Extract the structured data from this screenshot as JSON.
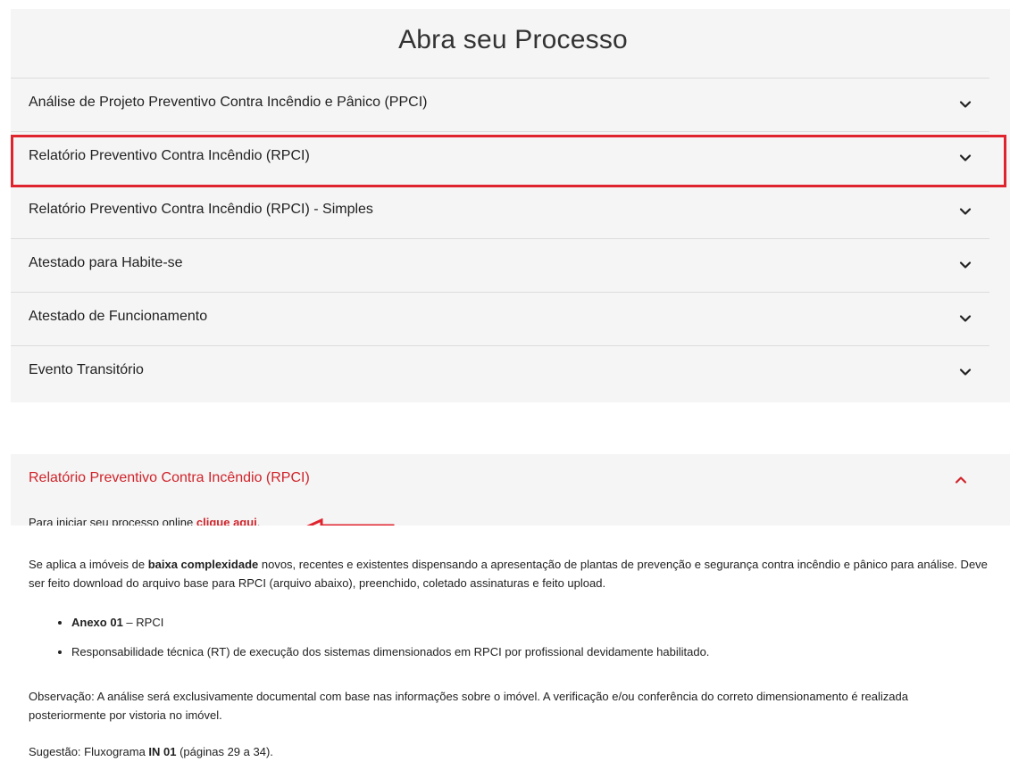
{
  "page": {
    "title": "Abra seu Processo"
  },
  "accordion": {
    "items": [
      {
        "label": "Análise de Projeto Preventivo Contra Incêndio e Pânico (PPCI)"
      },
      {
        "label": "Relatório Preventivo Contra Incêndio (RPCI)"
      },
      {
        "label": "Relatório Preventivo Contra Incêndio (RPCI) - Simples"
      },
      {
        "label": "Atestado para Habite-se"
      },
      {
        "label": "Atestado de Funcionamento"
      },
      {
        "label": "Evento Transitório"
      }
    ],
    "highlighted_index": 1
  },
  "expanded": {
    "header": "Relatório Preventivo Contra Incêndio (RPCI)",
    "intro_prefix": "Para iniciar seu processo online ",
    "intro_link": "clique aqui",
    "intro_suffix": ".",
    "para1_prefix": "Se aplica a imóveis de ",
    "para1_bold": "baixa complexidade",
    "para1_suffix": " novos, recentes e existentes dispensando a apresentação de plantas de prevenção e segurança contra incêndio e pânico para análise. Deve ser feito download do arquivo base para RPCI (arquivo abaixo), preenchido, coletado assinaturas e feito upload.",
    "bullets": {
      "b1_bold": "Anexo 01",
      "b1_rest": " – RPCI",
      "b2": "Responsabilidade técnica (RT) de execução dos sistemas dimensionados em RPCI por profissional devidamente habilitado."
    },
    "observation": "Observação: A análise será exclusivamente documental com base nas informações sobre o imóvel. A verificação e/ou conferência do correto dimensionamento é realizada posteriormente por vistoria no imóvel.",
    "suggestion_prefix": "Sugestão: Fluxograma ",
    "suggestion_bold": "IN 01",
    "suggestion_suffix": " (páginas 29 a 34)."
  },
  "colors": {
    "accent_red": "#d0242b",
    "highlight_red": "#e0242e",
    "panel_bg": "#f5f5f5"
  },
  "icons": {
    "collapsed": "chevron-down-icon",
    "expanded": "chevron-up-icon",
    "annotation": "arrow-left-icon"
  }
}
